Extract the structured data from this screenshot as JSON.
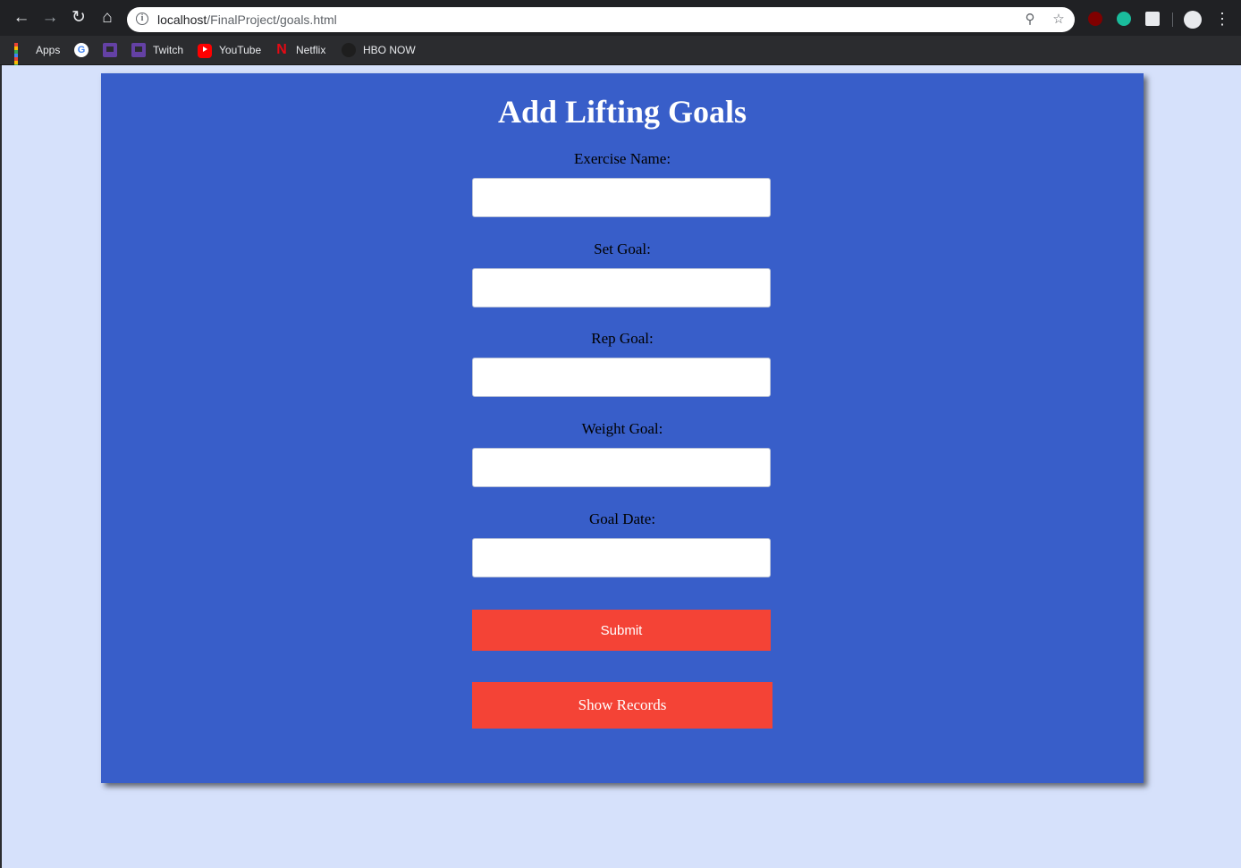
{
  "browser": {
    "url_host": "localhost",
    "url_path": "/FinalProject/goals.html",
    "bookmarks": [
      {
        "label": "Apps",
        "icon": "apps-grid-icon"
      },
      {
        "label": "",
        "icon": "google-icon"
      },
      {
        "label": "",
        "icon": "twitch-icon"
      },
      {
        "label": "Twitch",
        "icon": "twitch-icon"
      },
      {
        "label": "YouTube",
        "icon": "youtube-icon"
      },
      {
        "label": "Netflix",
        "icon": "netflix-icon"
      },
      {
        "label": "HBO NOW",
        "icon": "hbo-icon"
      }
    ]
  },
  "page": {
    "title": "Add Lifting Goals",
    "fields": [
      {
        "label": "Exercise Name:",
        "value": ""
      },
      {
        "label": "Set Goal:",
        "value": ""
      },
      {
        "label": "Rep Goal:",
        "value": ""
      },
      {
        "label": "Weight Goal:",
        "value": ""
      },
      {
        "label": "Goal Date:",
        "value": ""
      }
    ],
    "submit_label": "Submit",
    "show_records_label": "Show Records"
  },
  "colors": {
    "page_background": "#d6e1fb",
    "card_background": "#385ec9",
    "button_background": "#f44336",
    "title_color": "#ffffff"
  }
}
